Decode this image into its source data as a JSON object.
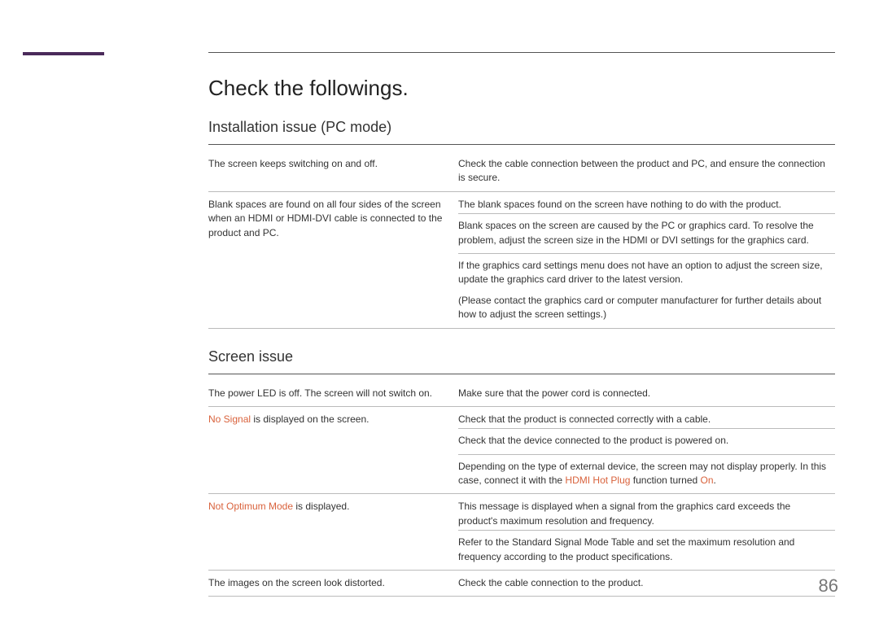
{
  "pageNumber": "86",
  "title": "Check the followings.",
  "sections": [
    {
      "heading": "Installation issue (PC mode)",
      "rows": [
        {
          "left": "The screen keeps switching on and off.",
          "right": "Check the cable connection between the product and PC, and ensure the connection is secure."
        },
        {
          "left": "Blank spaces are found on all four sides of the screen when an HDMI or HDMI-DVI cable is connected to the product and PC.",
          "rightParts": [
            "The blank spaces found on the screen have nothing to do with the product.",
            "Blank spaces on the screen are caused by the PC or graphics card. To resolve the problem, adjust the screen size in the HDMI or DVI settings for the graphics card.",
            "If the graphics card settings menu does not have an option to adjust the screen size, update the graphics card driver to the latest version.",
            "(Please contact the graphics card or computer manufacturer for further details about how to adjust the screen settings.)"
          ]
        }
      ]
    },
    {
      "heading": "Screen issue",
      "rows": [
        {
          "left": "The power LED is off. The screen will not switch on.",
          "right": "Make sure that the power cord is connected."
        },
        {
          "leftParts": [
            {
              "text": "No Signal",
              "hl": true
            },
            {
              "text": " is displayed on the screen."
            }
          ],
          "rightParts": [
            "Check that the product is connected correctly with a cable.",
            "Check that the device connected to the product is powered on."
          ],
          "extra": {
            "prefix": "Depending on the type of external device, the screen may not display properly. In this case, connect it with the ",
            "hl1": "HDMI Hot Plug",
            "mid": " function turned ",
            "hl2": "On",
            "suffix": "."
          }
        },
        {
          "leftParts": [
            {
              "text": "Not Optimum Mode",
              "hl": true
            },
            {
              "text": " is displayed."
            }
          ],
          "rightParts": [
            "This message is displayed when a signal from the graphics card exceeds the product's maximum resolution and frequency.",
            "Refer to the Standard Signal Mode Table and set the maximum resolution and frequency according to the product specifications."
          ]
        },
        {
          "left": "The images on the screen look distorted.",
          "right": "Check the cable connection to the product."
        }
      ]
    }
  ]
}
